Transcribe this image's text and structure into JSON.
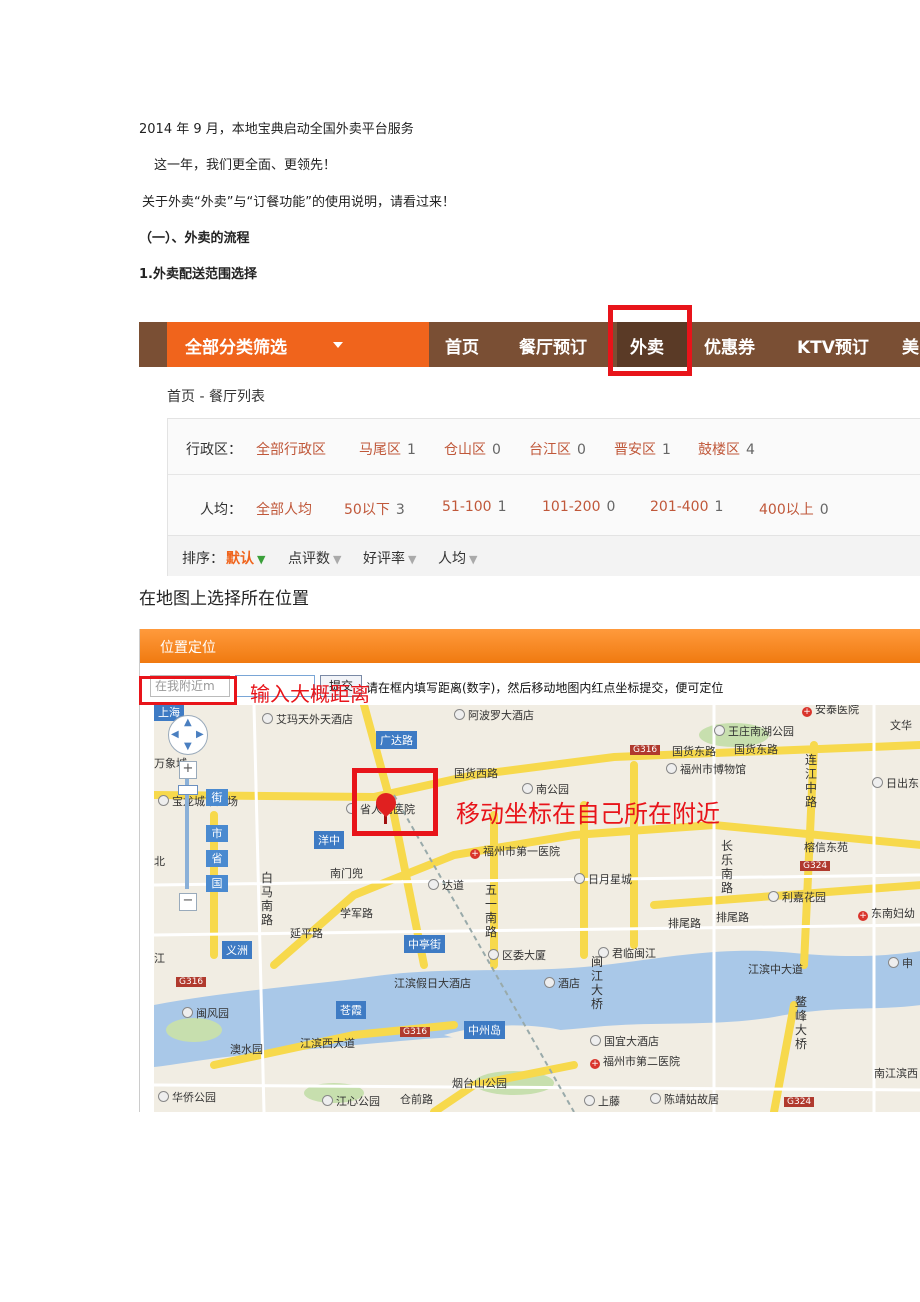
{
  "doc": {
    "p1": "2014 年 9 月，本地宝典启动全国外卖平台服务",
    "p2": "这一年，我们更全面、更领先！",
    "p3": "关于外卖“外卖”与“订餐功能”的使用说明，请看过来！",
    "h1": "（一）、外卖的流程",
    "h2": "1.外卖配送范围选择",
    "p4": "在地图上选择所在位置"
  },
  "shot1": {
    "category_btn": "全部分类筛选",
    "nav": [
      "首页",
      "餐厅预订",
      "外卖",
      "优惠券",
      "KTV预订",
      "美"
    ],
    "active_nav": "外卖",
    "breadcrumb": "首页 - 餐厅列表",
    "district_label": "行政区：",
    "districts": [
      {
        "name": "全部行政区",
        "count": ""
      },
      {
        "name": "马尾区",
        "count": "1"
      },
      {
        "name": "仓山区",
        "count": "0"
      },
      {
        "name": "台江区",
        "count": "0"
      },
      {
        "name": "晋安区",
        "count": "1"
      },
      {
        "name": "鼓楼区",
        "count": "4"
      }
    ],
    "price_label": "人均：",
    "prices": [
      {
        "name": "全部人均",
        "count": ""
      },
      {
        "name": "50以下",
        "count": "3"
      },
      {
        "name": "51-100",
        "count": "1"
      },
      {
        "name": "101-200",
        "count": "0"
      },
      {
        "name": "201-400",
        "count": "1"
      },
      {
        "name": "400以上",
        "count": "0"
      }
    ],
    "sort_label": "排序：",
    "sorts": [
      "默认",
      "点评数",
      "好评率",
      "人均"
    ]
  },
  "shot2": {
    "header": "位置定位",
    "input_placeholder": "在我附近m",
    "submit": "提交",
    "hint": "请在框内填写距离(数字)，然后移动地图内红点坐标提交，便可定位",
    "annotation_input": "输入大概距离",
    "annotation_pin": "移动坐标在自己所在附近",
    "zoom_tabs": [
      "街",
      "市",
      "省",
      "国"
    ],
    "map_labels": {
      "l1": "艾玛天外天酒店",
      "l2": "阿波罗大酒店",
      "l3": "安泰医院",
      "l4": "王庄南湖公园",
      "l5": "文华",
      "l6": "上海",
      "l7": "万象城",
      "l8": "广达路",
      "l9": "国货东路",
      "l10": "国货东路",
      "l11": "福州市博物馆",
      "l12": "连江中路",
      "l13": "日出东",
      "l14": "国货西路",
      "l15": "南公园",
      "l16": "宝龙城市广场",
      "l17": "省人民医院",
      "l18": "洋中",
      "l19": "福州市第一医院",
      "l20": "榕信东苑",
      "l21": "长乐南路",
      "l22": "日月星城",
      "l23": "利嘉花园",
      "l24": "达道",
      "l25": "五一南路",
      "l26": "白马南路",
      "l27": "学军路",
      "l28": "排尾路",
      "l29": "排尾路",
      "l30": "东南妇幼",
      "l31": "中亭街",
      "l32": "区委大厦",
      "l33": "君临闽江",
      "l34": "义洲",
      "l35": "延平路",
      "l36": "江滨中大道",
      "l37": "江滨假日大酒店",
      "l38": "酒店",
      "l39": "闽江大桥",
      "l40": "苍霞",
      "l41": "中州岛",
      "l42": "闽风园",
      "l43": "国宜大酒店",
      "l44": "鳌峰大桥",
      "l45": "福州市第二医院",
      "l46": "江滨西大道",
      "l47": "澳水园",
      "l48": "烟台山公园",
      "l49": "华侨公园",
      "l50": "江心公园",
      "l51": "仓前路",
      "l52": "上藤",
      "l53": "陈靖姑故居",
      "l54": "南江滨西",
      "l55": "申",
      "l56": "江",
      "l57": "北",
      "l58": "南门兜"
    },
    "road_shields": [
      "G316",
      "G316",
      "G316",
      "G324",
      "G324"
    ]
  }
}
